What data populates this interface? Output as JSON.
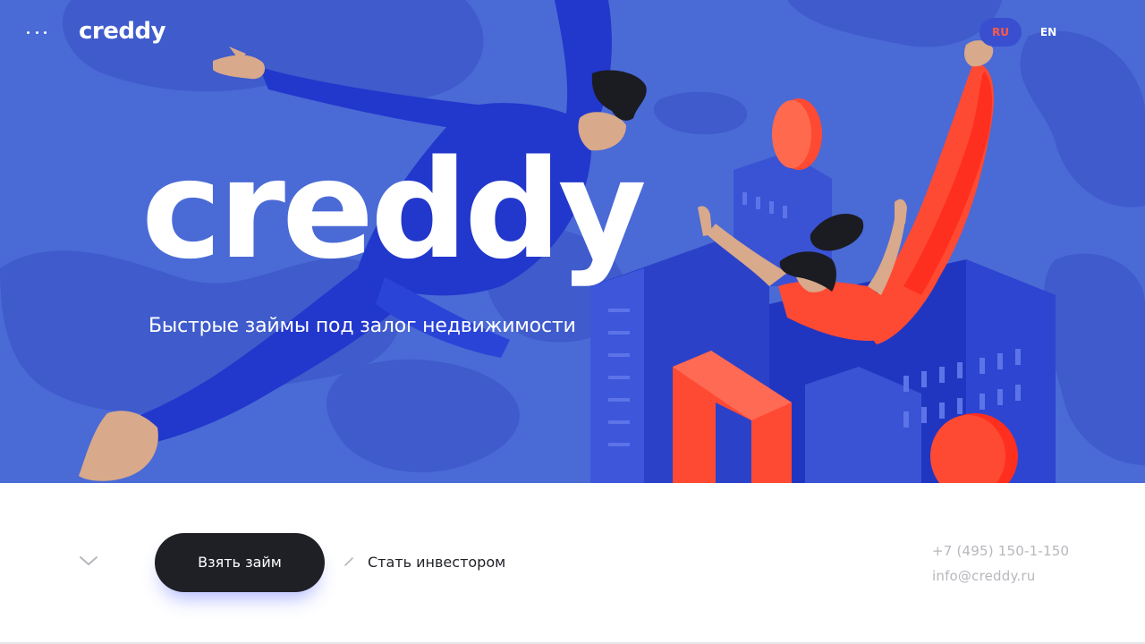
{
  "colors": {
    "hero_background": "#4a6ad6",
    "accent_red": "#ff4a33",
    "button_dark": "#1f2026",
    "muted_text": "#b7b7bd"
  },
  "header": {
    "menu_icon": "more-dots-icon",
    "logo_text": "creddy",
    "languages": [
      {
        "label": "RU",
        "active": true
      },
      {
        "label": "EN",
        "active": false
      }
    ]
  },
  "hero": {
    "logo_text": "creddy",
    "tagline": "Быстрые займы под залог недвижимости"
  },
  "actions": {
    "scroll_icon": "chevron-down-icon",
    "primary_button_label": "Взять займ",
    "separator_icon": "slash-icon",
    "secondary_link_label": "Стать инвестором"
  },
  "contacts": {
    "phone": "+7 (495) 150-1-150",
    "email": "info@creddy.ru"
  }
}
